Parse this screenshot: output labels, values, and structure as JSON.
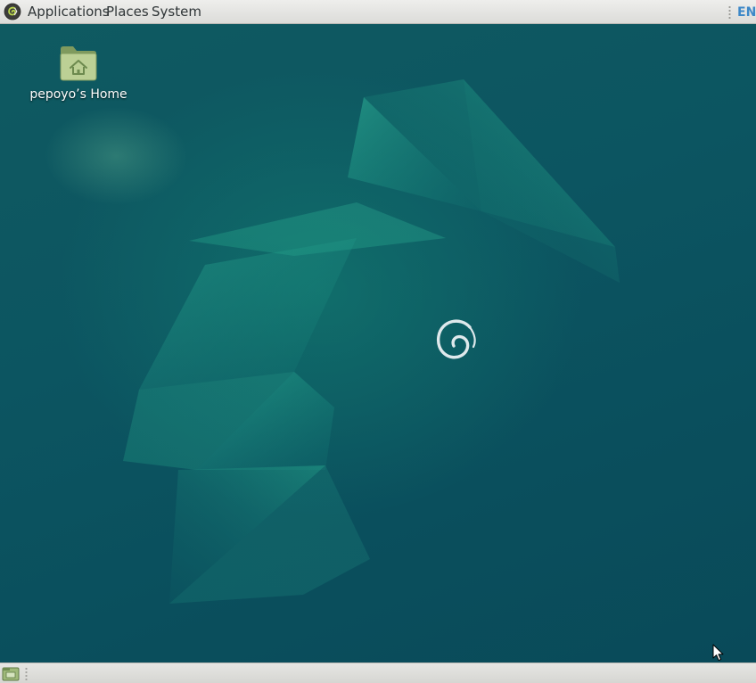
{
  "top_panel": {
    "menu_icon": "debian-swirl-icon",
    "menus": {
      "applications": "Applications",
      "places": "Places",
      "system": "System"
    },
    "keyboard_layout": "EN"
  },
  "desktop": {
    "icons": [
      {
        "icon": "home-folder-icon",
        "label": "pepoyo’s Home"
      }
    ],
    "wallpaper_logo": "debian-swirl-icon",
    "colors": {
      "background": "#0c5561",
      "accent": "#1f9a85"
    }
  },
  "bottom_panel": {
    "show_desktop_icon": "show-desktop-icon"
  }
}
